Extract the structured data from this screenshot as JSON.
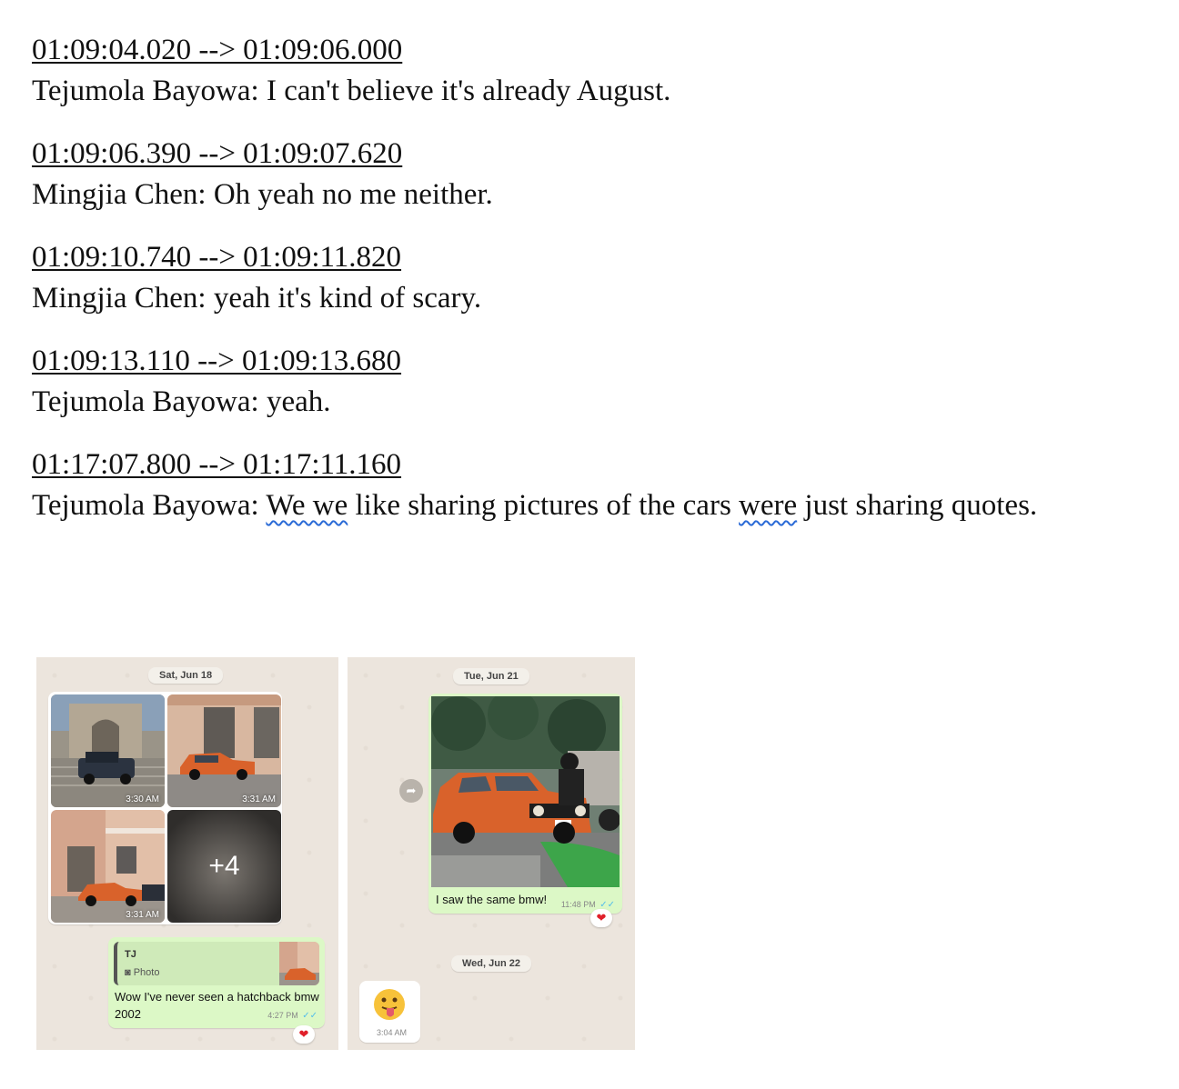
{
  "transcript": [
    {
      "timestamp": "01:09:04.020 --> 01:09:06.000",
      "text": "Tejumola Bayowa: I can't believe it's already August."
    },
    {
      "timestamp": "01:09:06.390 --> 01:09:07.620",
      "text": "Mingjia Chen: Oh yeah no me neither."
    },
    {
      "timestamp": "01:09:10.740 --> 01:09:11.820",
      "text": "Mingjia Chen: yeah it's kind of scary."
    },
    {
      "timestamp": "01:09:13.110 --> 01:09:13.680",
      "text": "Tejumola Bayowa: yeah."
    },
    {
      "timestamp": "01:17:07.800 --> 01:17:11.160",
      "last_parts": [
        "Tejumola Bayowa: ",
        "We we",
        " like sharing pictures of the cars ",
        "were",
        " just sharing quotes."
      ]
    }
  ],
  "chat1": {
    "date": "Sat, Jun 18",
    "photo_times": [
      "3:30 AM",
      "3:31 AM",
      "3:31 AM"
    ],
    "more_count": "+4",
    "reply": {
      "quote_name": "TJ",
      "quote_type": "Photo",
      "message": "Wow I've never seen a hatchback bmw 2002",
      "time": "4:27 PM",
      "reaction": "❤"
    }
  },
  "chat2": {
    "date1": "Tue, Jun 21",
    "message": "I saw the same bmw!",
    "time": "11:48 PM",
    "reaction": "❤",
    "date2": "Wed, Jun 22",
    "emoji_time": "3:04 AM"
  },
  "colors": {
    "bubble_out": "#dcf8c6",
    "chat_bg": "#ece5dd",
    "car_orange": "#d9622b",
    "spell_underline": "#2a6ad6"
  }
}
